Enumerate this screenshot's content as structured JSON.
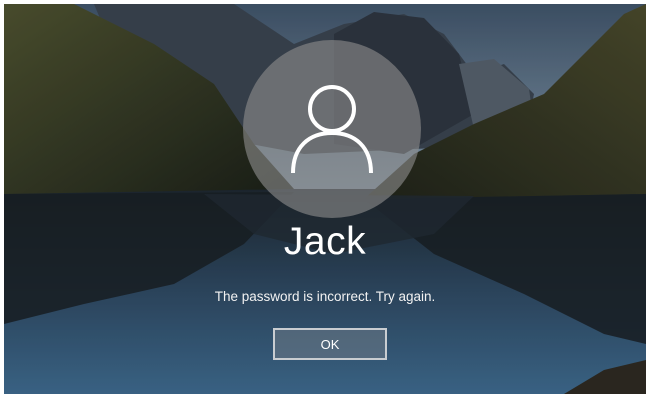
{
  "lock_screen": {
    "avatar_icon": "user-profile-icon",
    "username": "Jack",
    "error_message": "The password is incorrect. Try again.",
    "ok_label": "OK"
  },
  "colors": {
    "avatar_circle": "#8c8c8c",
    "text": "#ffffff",
    "button_border": "#c9cdd1"
  }
}
